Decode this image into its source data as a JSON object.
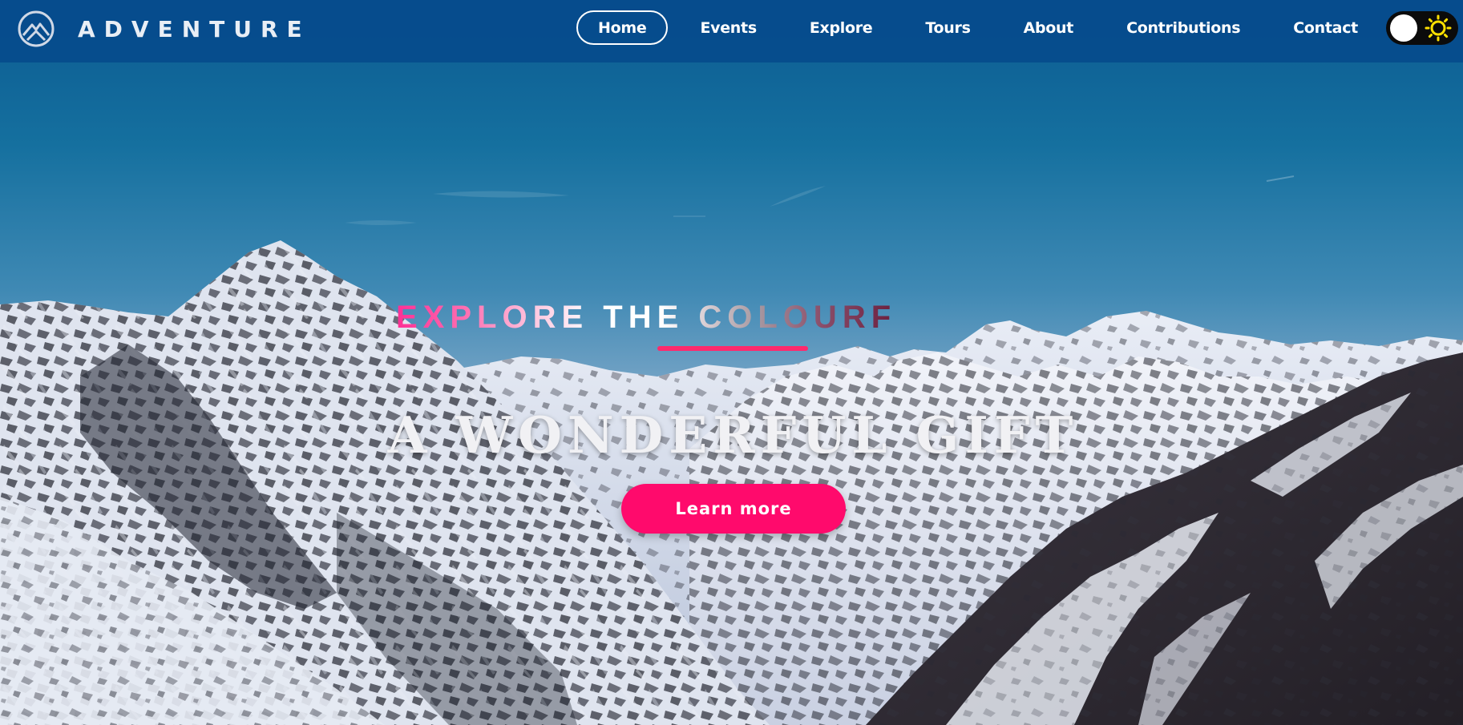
{
  "brand": {
    "name": "ADVENTURE",
    "logo_icon": "mountain-logo-icon"
  },
  "nav": {
    "items": [
      {
        "label": "Home",
        "active": true
      },
      {
        "label": "Events",
        "active": false
      },
      {
        "label": "Explore",
        "active": false
      },
      {
        "label": "Tours",
        "active": false
      },
      {
        "label": "About",
        "active": false
      },
      {
        "label": "Contributions",
        "active": false
      },
      {
        "label": "Contact",
        "active": false
      }
    ]
  },
  "theme_toggle": {
    "state": "light",
    "icon": "sun-icon"
  },
  "hero": {
    "tagline": "EXPLORE THE COLOURF",
    "headline": "A WONDERFUL GIFT",
    "cta_label": "Learn more"
  },
  "colors": {
    "nav_bg": "#064a8c",
    "accent": "#ff0a6c",
    "underline": "#ff2a6d",
    "sky_top": "#0d5e95",
    "sun": "#ffe100"
  }
}
